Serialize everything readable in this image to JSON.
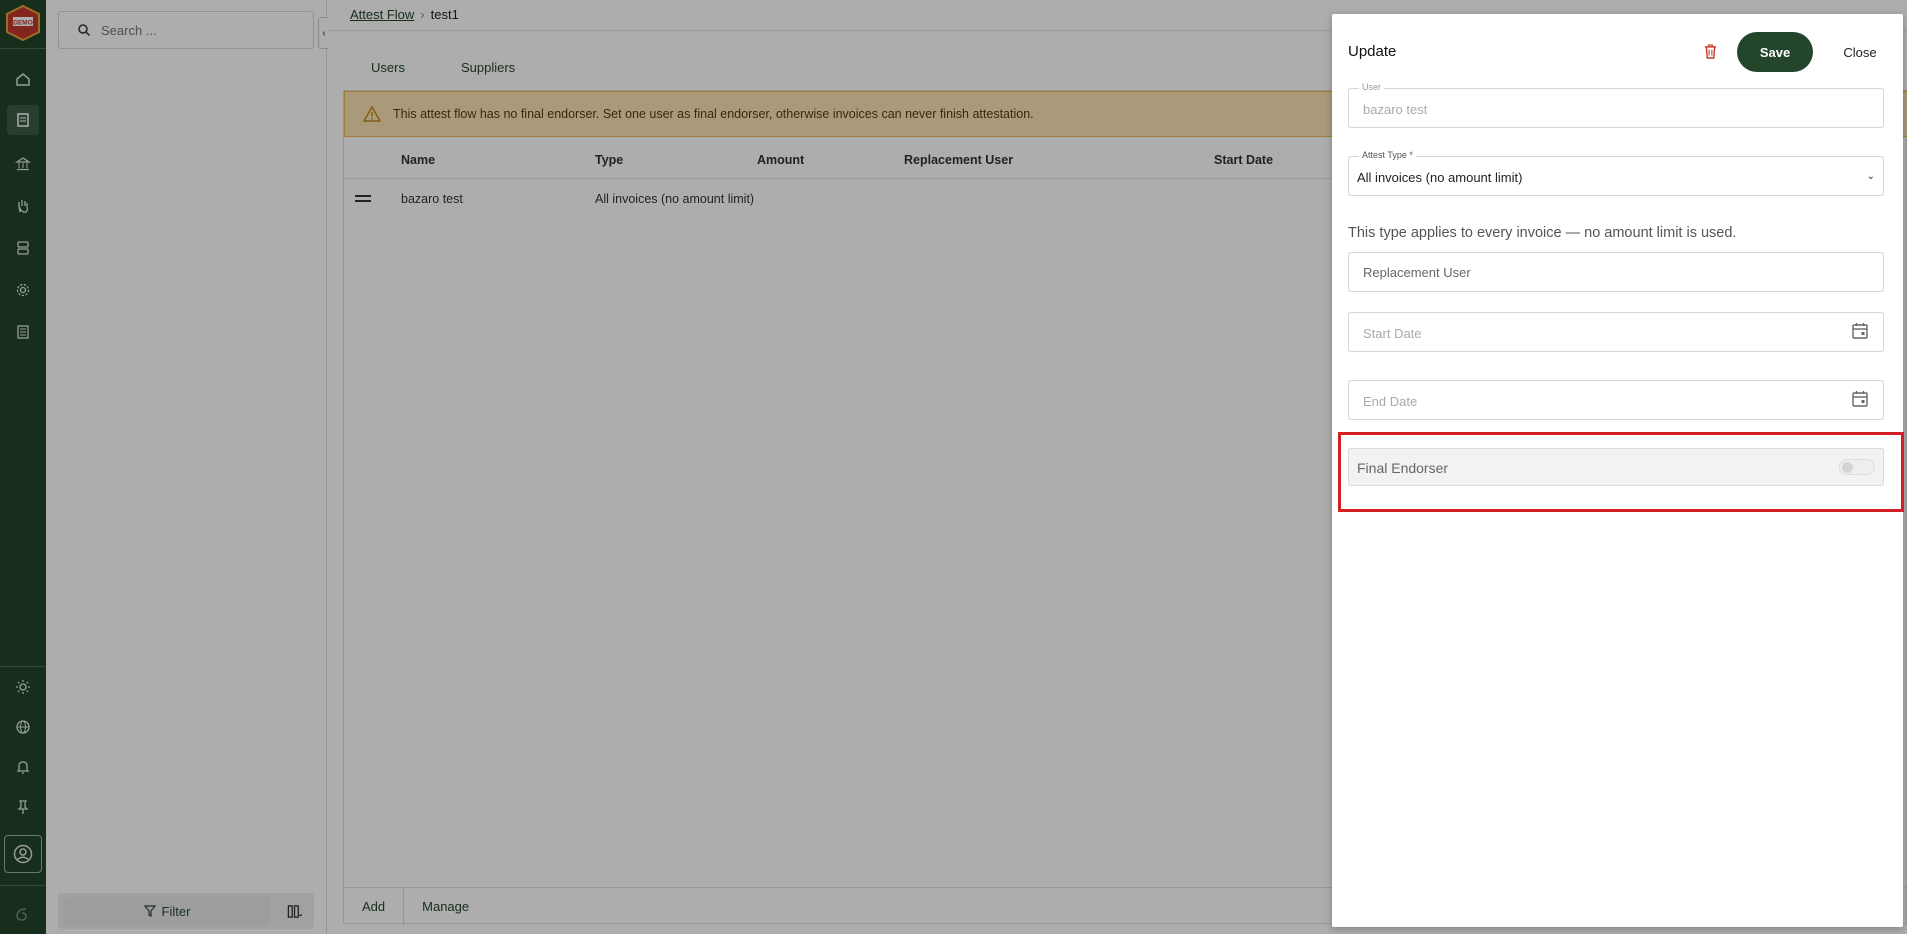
{
  "brand": {
    "logo_text": "DEMO"
  },
  "search": {
    "placeholder": "Search ..."
  },
  "sidebar_footer": {
    "filter_label": "Filter"
  },
  "breadcrumb": {
    "parent": "Attest Flow",
    "current": "test1"
  },
  "tabs": [
    {
      "label": "Users",
      "active": true
    },
    {
      "label": "Suppliers",
      "active": false
    }
  ],
  "warning": {
    "text": "This attest flow has no final endorser. Set one user as final endorser, otherwise invoices can never finish attestation."
  },
  "table": {
    "columns": [
      "Name",
      "Type",
      "Amount",
      "Replacement User",
      "Start Date"
    ],
    "rows": [
      {
        "name": "bazaro test",
        "type": "All invoices (no amount limit)",
        "amount": "",
        "replacement": "",
        "start": ""
      }
    ]
  },
  "footer": {
    "add_label": "Add",
    "manage_label": "Manage"
  },
  "panel": {
    "title": "Update",
    "save_label": "Save",
    "close_label": "Close",
    "user": {
      "label": "User",
      "value": "bazaro test"
    },
    "attest_type": {
      "label": "Attest Type *",
      "value": "All invoices (no amount limit)"
    },
    "hint": "This type applies to every invoice — no amount limit is used.",
    "replacement": {
      "placeholder": "Replacement User"
    },
    "start_date": {
      "placeholder": "Start Date"
    },
    "end_date": {
      "placeholder": "End Date"
    },
    "final_endorser": {
      "label": "Final Endorser",
      "on": false
    }
  },
  "colors": {
    "brand_green": "#22452b",
    "warning_bg": "#fce3b3",
    "highlight": "#d32027"
  }
}
